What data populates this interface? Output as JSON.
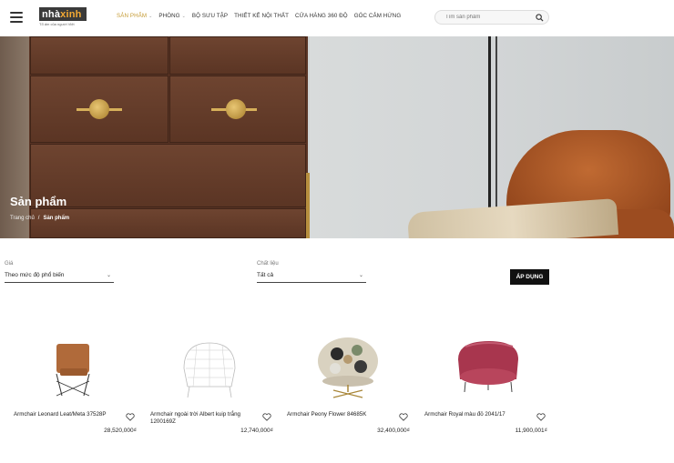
{
  "header": {
    "logo": {
      "brand_part1": "nhà",
      "brand_part2": "xinh",
      "tagline": "Tổ ấm của người Việt"
    },
    "nav": [
      {
        "label": "SẢN PHẨM",
        "has_dropdown": true,
        "active": true
      },
      {
        "label": "PHÒNG",
        "has_dropdown": true,
        "active": false
      },
      {
        "label": "BỘ SƯU TẬP",
        "has_dropdown": false,
        "active": false
      },
      {
        "label": "THIẾT KẾ NỘI THẤT",
        "has_dropdown": false,
        "active": false
      },
      {
        "label": "CỬA HÀNG 360 ĐỘ",
        "has_dropdown": false,
        "active": false
      },
      {
        "label": "GÓC CẢM HỨNG",
        "has_dropdown": false,
        "active": false
      }
    ],
    "search": {
      "placeholder": "Tìm sản phẩm",
      "value": "",
      "icon": "search-icon"
    }
  },
  "hero": {
    "title": "Sản phẩm",
    "breadcrumb": {
      "home": "Trang chủ",
      "separator": "/",
      "current": "Sản phẩm"
    }
  },
  "filters": {
    "price": {
      "label": "Giá",
      "selected": "Theo mức độ phổ biến"
    },
    "material": {
      "label": "Chất liệu",
      "selected": "Tất cả"
    },
    "apply_label": "ÁP DỤNG"
  },
  "products": [
    {
      "name": "Armchair Leonard Leat/Meta 37528P",
      "price": "28,520,000₫",
      "image": "leather-armchair"
    },
    {
      "name": "Armchair ngoài trời Albert kuip trắng 1200169Z",
      "price": "12,740,000₫",
      "image": "white-wire-chair"
    },
    {
      "name": "Armchair Peony Flower 84685K",
      "price": "32,400,000₫",
      "image": "floral-swivel-chair"
    },
    {
      "name": "Armchair Royal màu đỏ 2041/17",
      "price": "11,900,001₫",
      "image": "red-velvet-chair"
    }
  ],
  "colors": {
    "accent": "#c59b35",
    "button": "#111111",
    "logo_bg": "#3a3a3a"
  }
}
